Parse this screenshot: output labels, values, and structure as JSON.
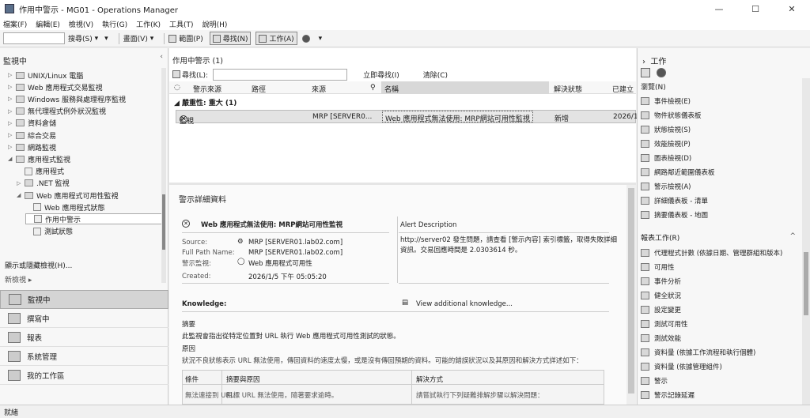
{
  "window": {
    "title": "作用中警示 - MG01 - Operations Manager",
    "minimize": "—",
    "maximize": "☐",
    "close": "✕"
  },
  "menu": [
    "檔案(F)",
    "編輯(E)",
    "檢視(V)",
    "執行(G)",
    "工作(K)",
    "工具(T)",
    "說明(H)"
  ],
  "toolbar": {
    "search_label": "搜尋(S)",
    "scope_label": "範圍(P)",
    "find_label": "尋找(N)",
    "tasks_label": "工作(A)",
    "view_label": "畫面(V)"
  },
  "left": {
    "header": "監視中",
    "collapse": "‹",
    "tree": [
      {
        "label": "UNIX/Linux 電腦",
        "indent": 0,
        "twisty": "▷",
        "kind": "folder"
      },
      {
        "label": "Web 應用程式交易監視",
        "indent": 0,
        "twisty": "▷",
        "kind": "folder"
      },
      {
        "label": "Windows 服務與處理程序監視",
        "indent": 0,
        "twisty": "▷",
        "kind": "folder"
      },
      {
        "label": "無代理程式例外狀況監視",
        "indent": 0,
        "twisty": "▷",
        "kind": "folder"
      },
      {
        "label": "資料倉儲",
        "indent": 0,
        "twisty": "▷",
        "kind": "folder"
      },
      {
        "label": "綜合交易",
        "indent": 0,
        "twisty": "▷",
        "kind": "folder"
      },
      {
        "label": "網路監視",
        "indent": 0,
        "twisty": "▷",
        "kind": "folder"
      },
      {
        "label": "應用程式監視",
        "indent": 0,
        "twisty": "◢",
        "kind": "folder"
      },
      {
        "label": "應用程式",
        "indent": 1,
        "twisty": "",
        "kind": "doc"
      },
      {
        "label": ".NET 監視",
        "indent": 1,
        "twisty": "▷",
        "kind": "folder"
      },
      {
        "label": "Web 應用程式可用性監視",
        "indent": 1,
        "twisty": "◢",
        "kind": "folder"
      },
      {
        "label": "Web 應用程式狀態",
        "indent": 2,
        "twisty": "",
        "kind": "doc"
      },
      {
        "label": "作用中警示",
        "indent": 2,
        "twisty": "",
        "kind": "doc",
        "selected": true
      },
      {
        "label": "測試狀態",
        "indent": 2,
        "twisty": "",
        "kind": "doc"
      }
    ],
    "show_hide": "顯示或隱藏檢視(H)...",
    "new_view": "新檢視 ▸",
    "wunderbar": [
      {
        "label": "監視中",
        "active": true
      },
      {
        "label": "撰寫中"
      },
      {
        "label": "報表"
      },
      {
        "label": "系統管理"
      },
      {
        "label": "我的工作區"
      }
    ]
  },
  "center": {
    "title": "作用中警示 (1)",
    "find_label": "尋找(L):",
    "find_now": "立即尋找(I)",
    "clear": "清除(C)",
    "columns": [
      "警示來源",
      "路徑",
      "來源",
      "名稱",
      "解決狀態",
      "已建立"
    ],
    "group": "◢  嚴重性: 重大 (1)",
    "row": {
      "source": "監視",
      "path": "",
      "origin": "MRP [SERVER0...",
      "name": "Web 應用程式無法使用: MRP網站可用性監視",
      "state": "新增",
      "created": "2026/1/..."
    }
  },
  "details": {
    "title": "警示詳細資料",
    "alert_name": "Web 應用程式無法使用: MRP網站可用性監視",
    "source_label": "Source:",
    "source_value": "MRP [SERVER01.lab02.com]",
    "fullpath_label": "Full Path Name:",
    "fullpath_value": "MRP [SERVER01.lab02.com]",
    "monitor_label": "警示監視:",
    "monitor_value": "Web 應用程式可用性",
    "created_label": "Created:",
    "created_value": "2026/1/5 下午 05:05:20",
    "desc_label": "Alert Description",
    "desc_line1": "http://server02 發生問題，請查看 [警示內容] 索引標籤，取得失敗詳細",
    "desc_line2": "資訊。交易回應時間是 2.0303614 秒。",
    "knowledge_label": "Knowledge:",
    "view_knowledge": "View additional knowledge...",
    "summary_title": "摘要",
    "summary_text": "此監視會指出從特定位置對 URL 執行 Web 應用程式可用性測試的狀態。",
    "cause_title": "原因",
    "cause_text": "狀況不良狀態表示 URL 無法使用，傳回資料的速度太慢，或是沒有傳回預期的資料。可能的錯誤狀況以及其原因和解決方式詳述如下：",
    "table_headers": [
      "條件",
      "摘要與原因",
      "解決方式"
    ],
    "table_row": [
      "無法連接到 URL",
      "目標 URL 無法使用，隨著要求逾時。",
      "請嘗試執行下列疑難排解步驟以解決問題："
    ]
  },
  "right": {
    "header": "工作",
    "collapse": "›",
    "nav_section": "瀏覽(N)",
    "nav_items": [
      "事件檢視(E)",
      "物件狀態儀表板",
      "狀態檢視(S)",
      "效能檢視(P)",
      "圖表檢視(D)",
      "網路鄰近範圍儀表板",
      "警示檢視(A)",
      "詳細儀表板 - 清單",
      "摘要儀表板 - 地圖"
    ],
    "report_section": "報表工作(R)",
    "report_items": [
      "代理程式計數 (依據日期、管理群組和版本)",
      "可用性",
      "事件分析",
      "健全狀況",
      "設定變更",
      "測試可用性",
      "測試效能",
      "資料量 (依據工作流程和執行個體)",
      "資料量 (依據管理組件)",
      "警示",
      "警示記錄延遲"
    ],
    "caret": "^"
  },
  "status": "就緒"
}
